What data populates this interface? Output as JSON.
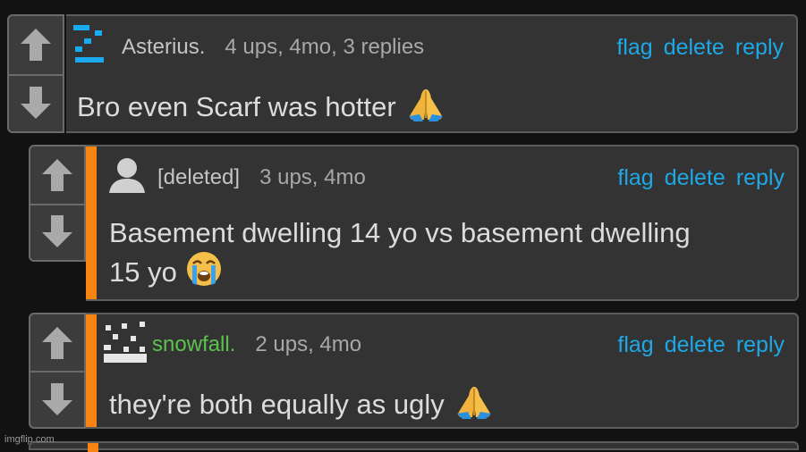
{
  "comments": [
    {
      "username": "Asterius.",
      "meta": "4 ups, 4mo, 3 replies",
      "text": "Bro even Scarf was hotter",
      "actions": {
        "flag": "flag",
        "delete": "delete",
        "reply": "reply"
      }
    },
    {
      "username": "[deleted]",
      "meta": "3 ups, 4mo",
      "text_line1": "Basement dwelling 14 yo vs basement dwelling",
      "text_line2": "15 yo",
      "actions": {
        "flag": "flag",
        "delete": "delete",
        "reply": "reply"
      }
    },
    {
      "username": "snowfall.",
      "meta": "2 ups, 4mo",
      "text": "they're both equally as ugly",
      "actions": {
        "flag": "flag",
        "delete": "delete",
        "reply": "reply"
      }
    }
  ],
  "watermark": "imgflip.com",
  "icons": {
    "upvote": "arrow-up-icon",
    "downvote": "arrow-down-icon",
    "pray": "folded-hands-emoji",
    "cry": "loudly-crying-face-emoji"
  },
  "colors": {
    "link": "#1ea8e6",
    "reply_bar": "#f7850f",
    "username_green": "#5cc24e",
    "avatar_blue": "#19aaf0"
  }
}
